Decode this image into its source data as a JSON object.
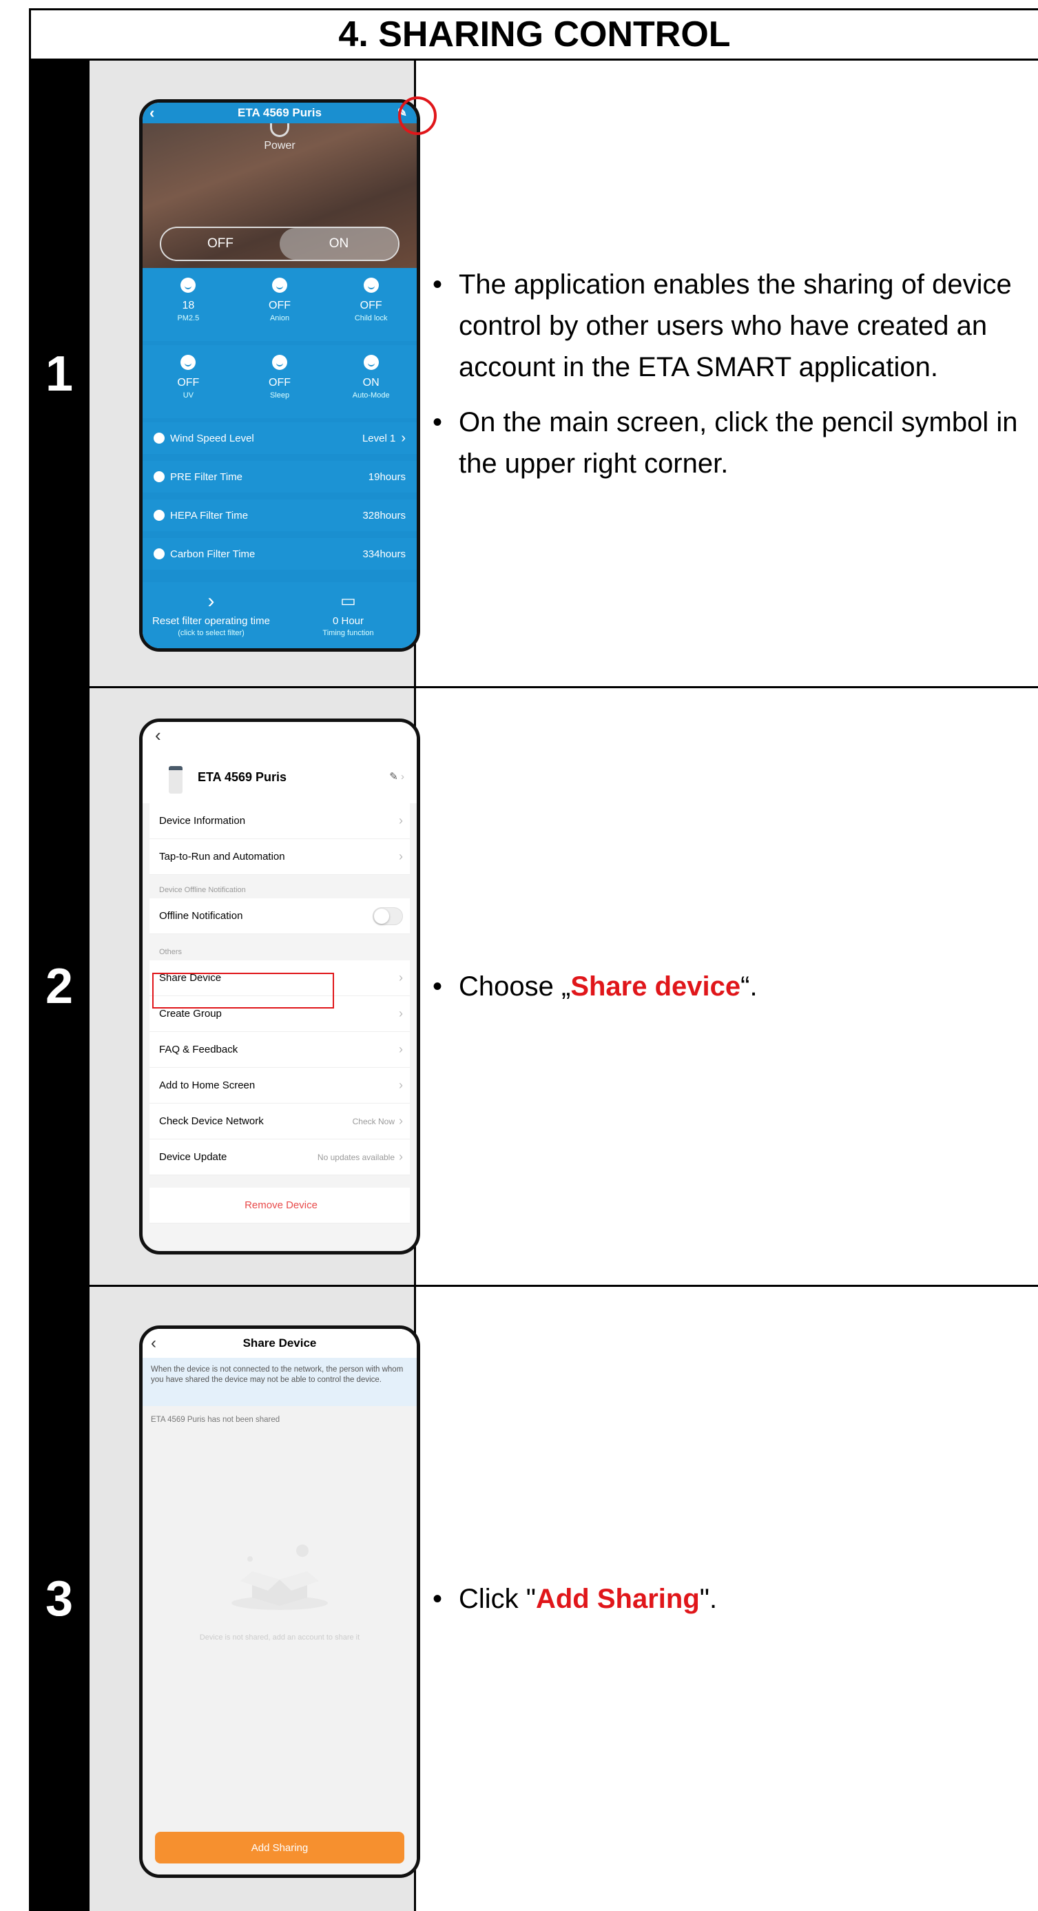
{
  "section_title": "4. SHARING CONTROL",
  "steps": [
    {
      "number": "1",
      "phone": {
        "header_title": "ETA 4569 Puris",
        "power_label": "Power",
        "toggle_off": "OFF",
        "toggle_on": "ON",
        "status_row1": [
          {
            "value": "18",
            "label": "PM2.5"
          },
          {
            "value": "OFF",
            "label": "Anion"
          },
          {
            "value": "OFF",
            "label": "Child lock"
          }
        ],
        "status_row2": [
          {
            "value": "OFF",
            "label": "UV"
          },
          {
            "value": "OFF",
            "label": "Sleep"
          },
          {
            "value": "ON",
            "label": "Auto-Mode"
          }
        ],
        "settings": [
          {
            "label": "Wind Speed Level",
            "value": "Level 1"
          },
          {
            "label": "PRE Filter Time",
            "value": "19hours"
          },
          {
            "label": "HEPA Filter Time",
            "value": "328hours"
          },
          {
            "label": "Carbon Filter Time",
            "value": "334hours"
          }
        ],
        "footer": [
          {
            "title": "Reset filter operating time",
            "subtitle": "(click to select filter)"
          },
          {
            "title": "0 Hour",
            "subtitle": "Timing function"
          }
        ]
      },
      "text": [
        "The application enables the sharing of device control by other users who have created an account in the ETA SMART application.",
        "On the main screen, click the pencil symbol in the upper right corner."
      ]
    },
    {
      "number": "2",
      "phone": {
        "device_name": "ETA 4569 Puris",
        "items_top": [
          "Device Information",
          "Tap-to-Run and Automation"
        ],
        "section_offline": "Device Offline Notification",
        "offline_item": "Offline Notification",
        "section_others": "Others",
        "others": [
          {
            "label": "Share Device",
            "right": ""
          },
          {
            "label": "Create Group",
            "right": ""
          },
          {
            "label": "FAQ & Feedback",
            "right": ""
          },
          {
            "label": "Add to Home Screen",
            "right": ""
          },
          {
            "label": "Check Device Network",
            "right": "Check Now"
          },
          {
            "label": "Device Update",
            "right": "No updates available"
          }
        ],
        "remove": "Remove Device"
      },
      "text_prefix": "Choose „",
      "text_highlight": "Share device",
      "text_suffix": "“."
    },
    {
      "number": "3",
      "phone": {
        "title": "Share Device",
        "note": "When the device is not connected to the network, the person with whom you have shared the device may not be able to control the device.",
        "not_shared": "ETA 4569 Puris has not been shared",
        "empty_hint": "Device is not shared, add an account to share it",
        "button": "Add Sharing"
      },
      "text_prefix": "Click \"",
      "text_highlight": "Add Sharing",
      "text_suffix": "\"."
    }
  ],
  "colors": {
    "app_blue": "#1a8fd0",
    "highlight_red": "#e0161a",
    "button_orange": "#f6902f"
  }
}
